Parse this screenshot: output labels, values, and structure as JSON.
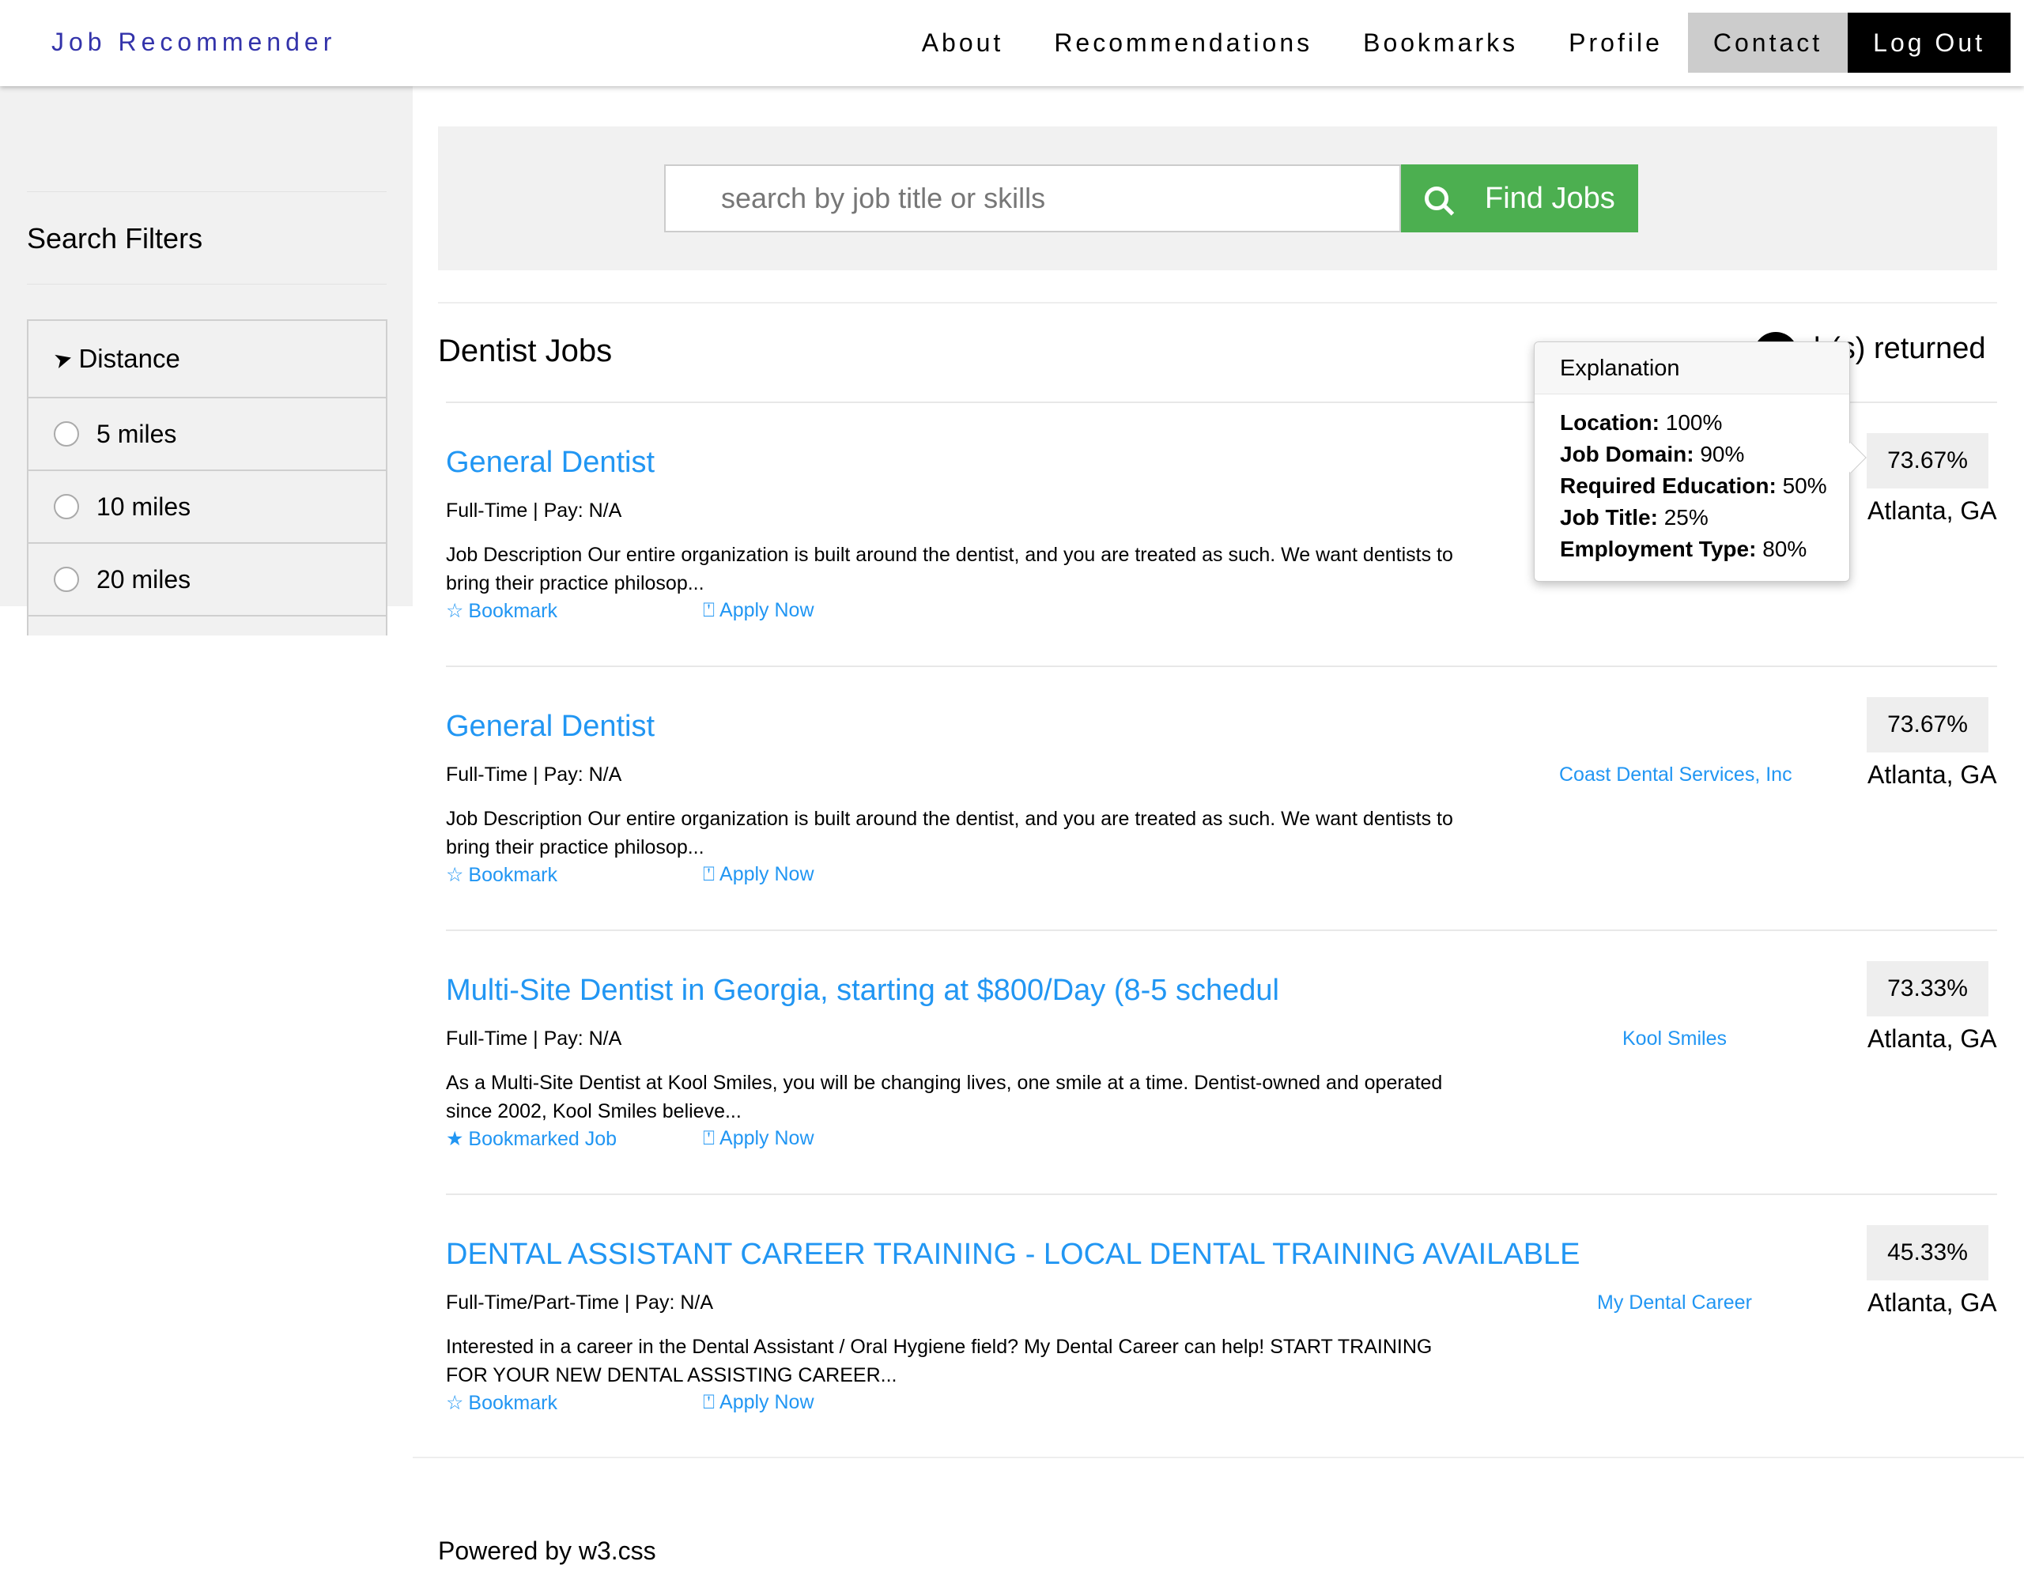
{
  "nav": {
    "brand": "Job Recommender",
    "items": [
      "About",
      "Recommendations",
      "Bookmarks",
      "Profile"
    ],
    "contact": "Contact",
    "logout": "Log Out"
  },
  "sidebar": {
    "title": "Search Filters",
    "filter_title": "Distance",
    "options": [
      "5 miles",
      "10 miles",
      "20 miles"
    ]
  },
  "search": {
    "placeholder": "search by job title or skills",
    "button": "Find Jobs"
  },
  "results": {
    "title": "Dentist Jobs",
    "returned_text": "(s) returned",
    "returned_prefix": "b"
  },
  "tooltip": {
    "title": "Explanation",
    "rows": [
      {
        "label": "Location:",
        "value": "100%"
      },
      {
        "label": "Job Domain:",
        "value": "90%"
      },
      {
        "label": "Required Education:",
        "value": "50%"
      },
      {
        "label": "Job Title:",
        "value": "25%"
      },
      {
        "label": "Employment Type:",
        "value": "80%"
      }
    ]
  },
  "jobs": [
    {
      "title": "General Dentist",
      "meta": "Full-Time | Pay: N/A",
      "desc": "Job Description Our entire organization is built around the dentist, and you are treated as such. We want dentists to bring their practice philosop...",
      "bookmark": "Bookmark",
      "apply": "Apply Now",
      "company": "",
      "score": "73.67%",
      "location": "Atlanta, GA"
    },
    {
      "title": "General Dentist",
      "meta": "Full-Time | Pay: N/A",
      "desc": "Job Description Our entire organization is built around the dentist, and you are treated as such. We want dentists to bring their practice philosop...",
      "bookmark": "Bookmark",
      "apply": "Apply Now",
      "company": "Coast Dental Services, Inc",
      "score": "73.67%",
      "location": "Atlanta, GA"
    },
    {
      "title": "Multi-Site Dentist in Georgia, starting at $800/Day (8-5 schedul",
      "meta": "Full-Time | Pay: N/A",
      "desc": "As a Multi-Site Dentist at Kool Smiles, you will be changing lives, one smile at a time. Dentist-owned and operated since 2002, Kool Smiles believe...",
      "bookmark": "Bookmarked Job",
      "apply": "Apply Now",
      "company": "Kool Smiles",
      "score": "73.33%",
      "location": "Atlanta, GA"
    },
    {
      "title": "DENTAL ASSISTANT CAREER TRAINING - LOCAL DENTAL TRAINING AVAILABLE",
      "meta": "Full-Time/Part-Time | Pay: N/A",
      "desc": "Interested in a career in the Dental Assistant / Oral Hygiene field? My Dental Career can help! START TRAINING FOR YOUR NEW DENTAL ASSISTING CAREER...",
      "bookmark": "Bookmark",
      "apply": "Apply Now",
      "company": "My Dental Career",
      "score": "45.33%",
      "location": "Atlanta, GA"
    }
  ],
  "footer": "Powered by w3.css",
  "icons": {
    "star_empty": "☆",
    "star_filled": "★",
    "bookmark": "🔖",
    "location_arrow": "➤"
  },
  "colors": {
    "brand": "#3333aa",
    "link": "#2196f3",
    "button_green": "#4caf50",
    "panel_gray": "#f1f1f1",
    "logout_bg": "#000000",
    "contact_bg": "#cccccc"
  }
}
